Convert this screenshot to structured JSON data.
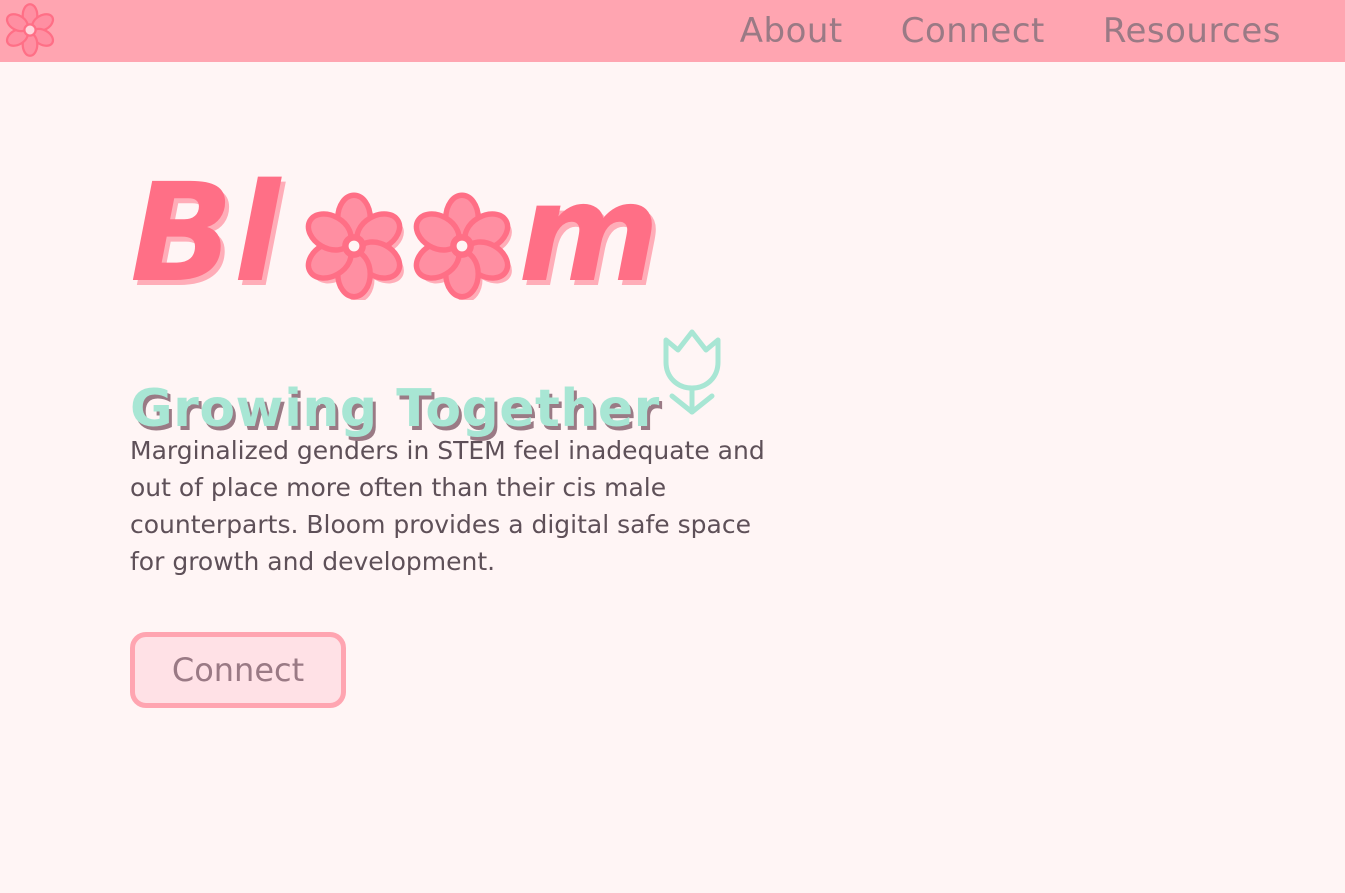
{
  "nav": {
    "logo_icon": "flower-icon",
    "links": [
      {
        "label": "About"
      },
      {
        "label": "Connect"
      },
      {
        "label": "Resources"
      }
    ]
  },
  "hero": {
    "brand": {
      "full_text": "Bloom",
      "leading": "Bl",
      "trailing": "m",
      "o_glyph_icon": "flower-icon"
    },
    "tagline": "Growing Together",
    "tagline_icon": "tulip-icon",
    "description": "Marginalized genders in STEM feel inadequate and out of place more often than their cis male counterparts. Bloom provides a digital safe space for growth and development.",
    "cta_label": "Connect"
  },
  "colors": {
    "nav_background": "#ffa5b1",
    "page_background": "#fff5f5",
    "brand_pink": "#ff6f86",
    "brand_shadow": "#ffadb8",
    "mint": "#a8e6d4",
    "muted_mauve": "#9a7a85",
    "body_text": "#5e5058",
    "button_fill": "#ffe1e6"
  }
}
